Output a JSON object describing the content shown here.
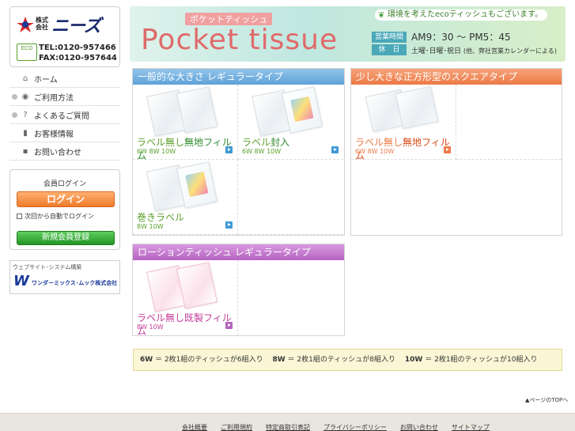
{
  "sidebar": {
    "logo": {
      "company_prefix": "株式会社",
      "company_name": "ニーズ",
      "eco_mark": "ECO",
      "tel": "TEL:0120-957466",
      "fax": "FAX:0120-957644"
    },
    "nav": [
      {
        "label": "ホーム",
        "icon": "home-icon"
      },
      {
        "label": "ご利用方法",
        "icon": "info-icon"
      },
      {
        "label": "よくあるご質問",
        "icon": "question-icon"
      },
      {
        "label": "お客様情報",
        "icon": "user-icon"
      },
      {
        "label": "お問い合わせ",
        "icon": "mail-icon"
      }
    ],
    "login": {
      "title": "会員ログイン",
      "login_button": "ログイン",
      "auto_login": "次回から自動でログイン",
      "register_button": "新規会員登録"
    },
    "credit": {
      "label": "ウェブサイト･システム構築",
      "name": "ワンダーミックス･ムック株式会社"
    }
  },
  "banner": {
    "subtitle": "ポケットティッシュ",
    "title": "Pocket tissue",
    "eco_note": "環境を考えたecoティッシュもございます。",
    "hours_label": "営業時間",
    "hours": "AM9：30 〜 PM5：45",
    "closed_label": "休　日",
    "closed": "土曜･日曜･祝日",
    "closed_note": "(他、弊社営業カレンダーによる)"
  },
  "sections": {
    "regular": {
      "title": "一般的な大きさ レギュラータイプ",
      "products": [
        {
          "name_a": "ラベル無し",
          "name_b": "無地フィルム",
          "sizes": "6W 8W 10W"
        },
        {
          "name_a": "ラベル",
          "name_b": "封入",
          "sizes": "6W 8W 10W"
        },
        {
          "name_a": "巻き",
          "name_b": "ラベル",
          "sizes": "8W 10W"
        }
      ]
    },
    "square": {
      "title": "少し大きな正方形型のスクエアタイプ",
      "products": [
        {
          "name_a": "ラベル無し",
          "name_b": "無地フィルム",
          "sizes": "6W 8W 10W"
        }
      ]
    },
    "lotion": {
      "title": "ローションティッシュ レギュラータイプ",
      "products": [
        {
          "name_a": "ラベル無し",
          "name_b": "既製フィルム",
          "sizes": "8W 10W"
        }
      ]
    }
  },
  "notes": {
    "w6_label": "6W",
    "w6_text": "＝ 2枚1組のティッシュが6組入り",
    "w8_label": "8W",
    "w8_text": "＝ 2枚1組のティッシュが8組入り",
    "w10_label": "10W",
    "w10_text": "＝ 2枚1組のティッシュが10組入り"
  },
  "pagetop": "▲ページのTOPへ",
  "footer": [
    "会社概要",
    "ご利用規約",
    "特定商取引表記",
    "プライバシーポリシー",
    "お問い合わせ",
    "サイトマップ"
  ],
  "colors": {
    "blue_header": "#5ea2d8",
    "orange_header": "#ec7a46",
    "purple_header": "#b463c0",
    "green_text": "#5aa02c",
    "pink_text": "#c23c9a"
  }
}
